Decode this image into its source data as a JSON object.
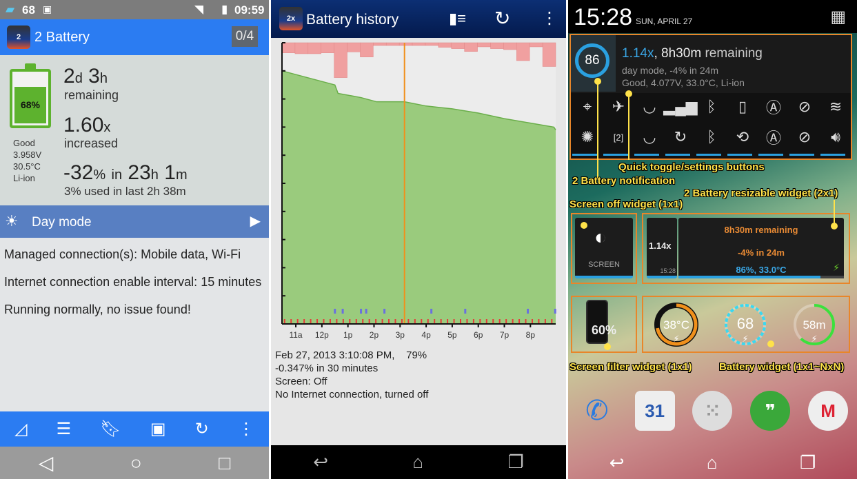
{
  "left": {
    "status": {
      "battery_level": "68",
      "time": "09:59"
    },
    "app_title": "2 Battery",
    "app_icon_label": "2",
    "counter": "0/4",
    "battery_percent": "68%",
    "battery_level_value": 68,
    "health": "Good",
    "voltage": "3.958V",
    "temperature": "30.5°C",
    "type": "Li-ion",
    "remaining_d": "2",
    "remaining_d_unit": "d",
    "remaining_h": "3",
    "remaining_h_unit": "h",
    "remaining_label": "remaining",
    "factor": "1.60",
    "factor_unit": "x",
    "factor_label": "increased",
    "drain_pct": "-32",
    "drain_pct_unit": "%",
    "drain_in": "in",
    "drain_h": "23",
    "drain_h_unit": "h",
    "drain_m": "1",
    "drain_m_unit": "m",
    "used_recent": "3% used in last 2h 38m",
    "mode_label": "Day mode",
    "body": [
      "Managed connection(s): Mobile data, Wi-Fi",
      "Internet connection enable interval: 15 minutes",
      "Running normally, no issue found!"
    ],
    "toolbar_icons": [
      "chart-icon",
      "sliders-icon",
      "bookmark-icon",
      "screenshot-icon",
      "refresh-icon",
      "more-icon"
    ]
  },
  "middle": {
    "title": "Battery history",
    "app_icon_label": "2x",
    "info": {
      "timestamp": "Feb 27, 2013 3:10:08 PM,",
      "level": "79%",
      "rate": "-0.347% in 30 minutes",
      "screen": "Screen: Off",
      "internet": "No Internet connection, turned off"
    }
  },
  "chart_data": {
    "type": "area",
    "x_tick_labels": [
      "11a",
      "12p",
      "1p",
      "2p",
      "3p",
      "4p",
      "5p",
      "6p",
      "7p",
      "8p"
    ],
    "x_range_hours": [
      10.47,
      20.97
    ],
    "ylim": [
      0,
      100
    ],
    "series": [
      {
        "values_hours": [
          10.47,
          12.5,
          12.62,
          13.5,
          14.1,
          15.17,
          16.0,
          17.0,
          18.0,
          19.0,
          19.95,
          20.9,
          20.97
        ],
        "level_pct": [
          90,
          85,
          82,
          80.5,
          79,
          79,
          77.5,
          76.5,
          75,
          73,
          71.5,
          70,
          69
        ]
      }
    ],
    "drain_bars_pct_per_30min": [
      1.28,
      1.39,
      1.39,
      1.28,
      4.4,
      1.16,
      1.8,
      0.35,
      0.35,
      0.35,
      0.35,
      0.35,
      0.58,
      0.75,
      1.1,
      0.52,
      0.75,
      0.87,
      2.26,
      0.52,
      3.0
    ],
    "screen_on_events_hours": [
      12.5,
      12.8,
      13.5,
      13.7,
      14.4,
      16.2,
      17.5,
      19.9,
      20.95
    ],
    "cursor_hour": 15.17,
    "colors": {
      "level": "#8cc66a",
      "drain": "#f0a0a0",
      "cursor": "#f0901c",
      "screen": "#6a70e0",
      "events": "#e83a3a"
    }
  },
  "right": {
    "time": "15:28",
    "date": "SUN, APRIL 27",
    "notification": {
      "level": "86",
      "factor": "1.14x",
      "sep": ",",
      "remaining_time": "8h30m",
      "remaining_word": "remaining",
      "line2": "day mode, -4% in 24m",
      "line3": "Good, 4.077V, 33.0°C, Li-ion"
    },
    "toggles_row1": [
      "location-icon",
      "airplane-icon",
      "wifi-icon",
      "signal-icon",
      "bluetooth-icon",
      "screen-icon",
      "auto-brightness-icon",
      "data-off-icon",
      "vibrate-off-icon"
    ],
    "toggles_row2": [
      "brightness-off-icon",
      "battery-2-icon",
      "wifi-icon",
      "sync-icon",
      "bluetooth-icon",
      "rotate-icon",
      "auto-brightness-icon",
      "data-off-icon",
      "volume-icon"
    ],
    "toggle_battery_num": "2",
    "annotations": {
      "quick_toggle": "Quick toggle/settings buttons",
      "notification": "2 Battery notification",
      "resizable": "2 Battery resizable widget (2x1)",
      "screen_off": "Screen off widget (1x1)",
      "screen_filter": "Screen filter widget (1x1)",
      "battery_widget": "Battery widget (1x1~NxN)"
    },
    "screen_widget_label": "SCREEN",
    "resizable": {
      "factor": "1.14x",
      "time": "15:28",
      "remaining": "8h30m remaining",
      "rate": "-4% in 24m",
      "status": "86%, 33.0°C",
      "level_fraction": 0.86
    },
    "filter_widget": "60%",
    "circle_widgets": [
      {
        "text": "38°C",
        "fraction": 0.72,
        "color": "#f0901c"
      },
      {
        "text": "68",
        "fraction": 0.68,
        "color": "#3ad8f0"
      },
      {
        "text": "58m",
        "fraction": 0.62,
        "color": "#3ce03c"
      }
    ],
    "dock": [
      "phone-icon",
      "calendar-icon",
      "apps-icon",
      "hangouts-icon",
      "gmail-icon"
    ],
    "calendar_day": "31"
  }
}
